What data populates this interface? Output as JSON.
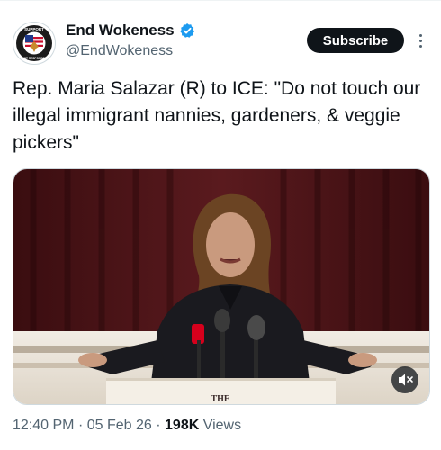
{
  "author": {
    "display_name": "End Wokeness",
    "handle": "@EndWokeness",
    "verified": true,
    "verified_color": "#1d9bf0",
    "avatar_icon": "eagle-flag-badge-icon",
    "avatar_text_top": "SUPPORT",
    "avatar_text_bottom": "FIRST RESPONDERS"
  },
  "header": {
    "subscribe_label": "Subscribe",
    "more_icon": "more-vertical-icon"
  },
  "tweet": {
    "text": "Rep. Maria Salazar (R) to ICE: \"Do not touch our illegal immigrant nannies, gardeners, & veggie pickers\""
  },
  "media": {
    "type": "video",
    "lectern_text": "THE",
    "mute_icon": "muted-speaker-icon"
  },
  "meta": {
    "time": "12:40 PM",
    "separator": "·",
    "date": "05 Feb 26",
    "views_count": "198K",
    "views_label": "Views"
  },
  "colors": {
    "text_primary": "#0f1419",
    "text_secondary": "#536471",
    "curtain": "#5a1a1e",
    "subscribe_bg": "#0f1419"
  }
}
